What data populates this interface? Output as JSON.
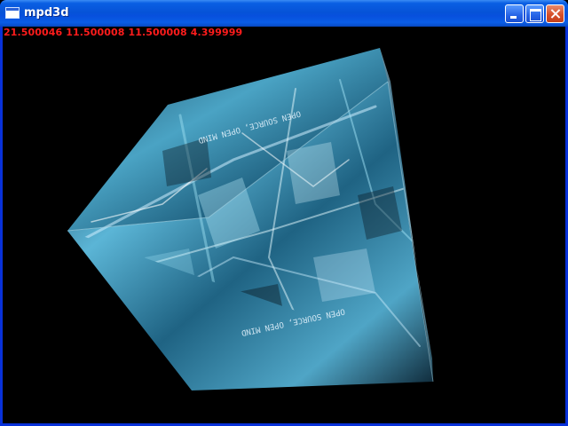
{
  "window": {
    "title": "mpd3d",
    "buttons": {
      "minimize": "minimize",
      "maximize": "maximize",
      "close": "close"
    }
  },
  "readout": "21.500046 11.500008 11.500008 4.399999",
  "cube": {
    "face_text": {
      "top": "OPEN SOURCE, OPEN MIND",
      "front": "OPEN SOURCE, OPEN MIND"
    },
    "colors": {
      "dark": "#0b1a26",
      "mid": "#3f8fb0",
      "light": "#9fe2f5",
      "highlight": "#e8fbff"
    }
  }
}
